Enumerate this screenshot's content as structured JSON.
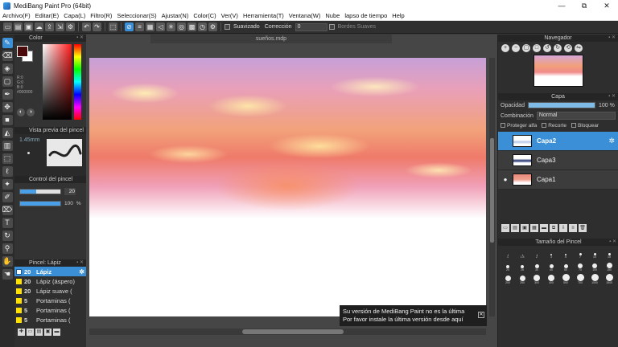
{
  "window": {
    "title": "MediBang Paint Pro (64bit)",
    "minimize": "—",
    "maximize": "⧉",
    "close": "✕"
  },
  "menu": [
    "Archivo(F)",
    "Editar(E)",
    "Capa(L)",
    "Filtro(R)",
    "Seleccionar(S)",
    "Ajustar(N)",
    "Color(C)",
    "Ver(V)",
    "Herramienta(T)",
    "Ventana(W)",
    "Nube",
    "lapso de tiempo",
    "Help"
  ],
  "toolbar": {
    "suavizado_label": "Suavizado",
    "correccion_label": "Corrección",
    "correccion_value": "0",
    "bordes_label": "Bordes Suaves"
  },
  "color_panel": {
    "title": "Color",
    "rgb": "R:0\nG:0\nB:0",
    "hex": "#000000",
    "fg_color": "#4a0a0a"
  },
  "brush_preview": {
    "title": "Vista previa del pincel",
    "size": "1.45mm"
  },
  "brush_control": {
    "title": "Control del pincel",
    "size_value": "20",
    "opacity_value": "100",
    "opacity_unit": "%",
    "size_fraction": 0.4,
    "opacity_fraction": 1.0
  },
  "brush_list": {
    "title": "Pincel: Lápiz",
    "items": [
      {
        "size": "20",
        "name": "Lápiz",
        "selected": true
      },
      {
        "size": "20",
        "name": "Lápiz (áspero)",
        "selected": false
      },
      {
        "size": "20",
        "name": "Lápiz suave (",
        "selected": false
      },
      {
        "size": "5",
        "name": "Portaminas (",
        "selected": false
      },
      {
        "size": "5",
        "name": "Portaminas (",
        "selected": false
      },
      {
        "size": "5",
        "name": "Portaminas (",
        "selected": false
      }
    ]
  },
  "canvas": {
    "tab_title": "sueños.mdp"
  },
  "notice": {
    "line1": "Su versión de MediBang Paint no es la última",
    "line2": "Por favor instale la última versión desde aquí",
    "close": "✕"
  },
  "navigator": {
    "title": "Navegador"
  },
  "layer_panel": {
    "title": "Capa",
    "opacity_label": "Opacidad",
    "opacity_value": "100 %",
    "blend_label": "Combinación",
    "blend_value": "Normal",
    "protect_alpha": "Proteger alfa",
    "clip": "Recorte",
    "lock": "Bloquear",
    "layers": [
      {
        "name": "Capa2",
        "selected": true
      },
      {
        "name": "Capa3",
        "selected": false
      },
      {
        "name": "Capa1",
        "selected": false
      }
    ]
  },
  "brush_size": {
    "title": "Tamaño del Pincel",
    "sizes": [
      "1",
      "1.5",
      "2",
      "3",
      "5",
      "7",
      "10",
      "15",
      "20",
      "25",
      "30",
      "40",
      "50",
      "70",
      "100",
      "150",
      "200",
      "250",
      "300",
      "400",
      "500",
      "700",
      "1000",
      "1500"
    ]
  }
}
